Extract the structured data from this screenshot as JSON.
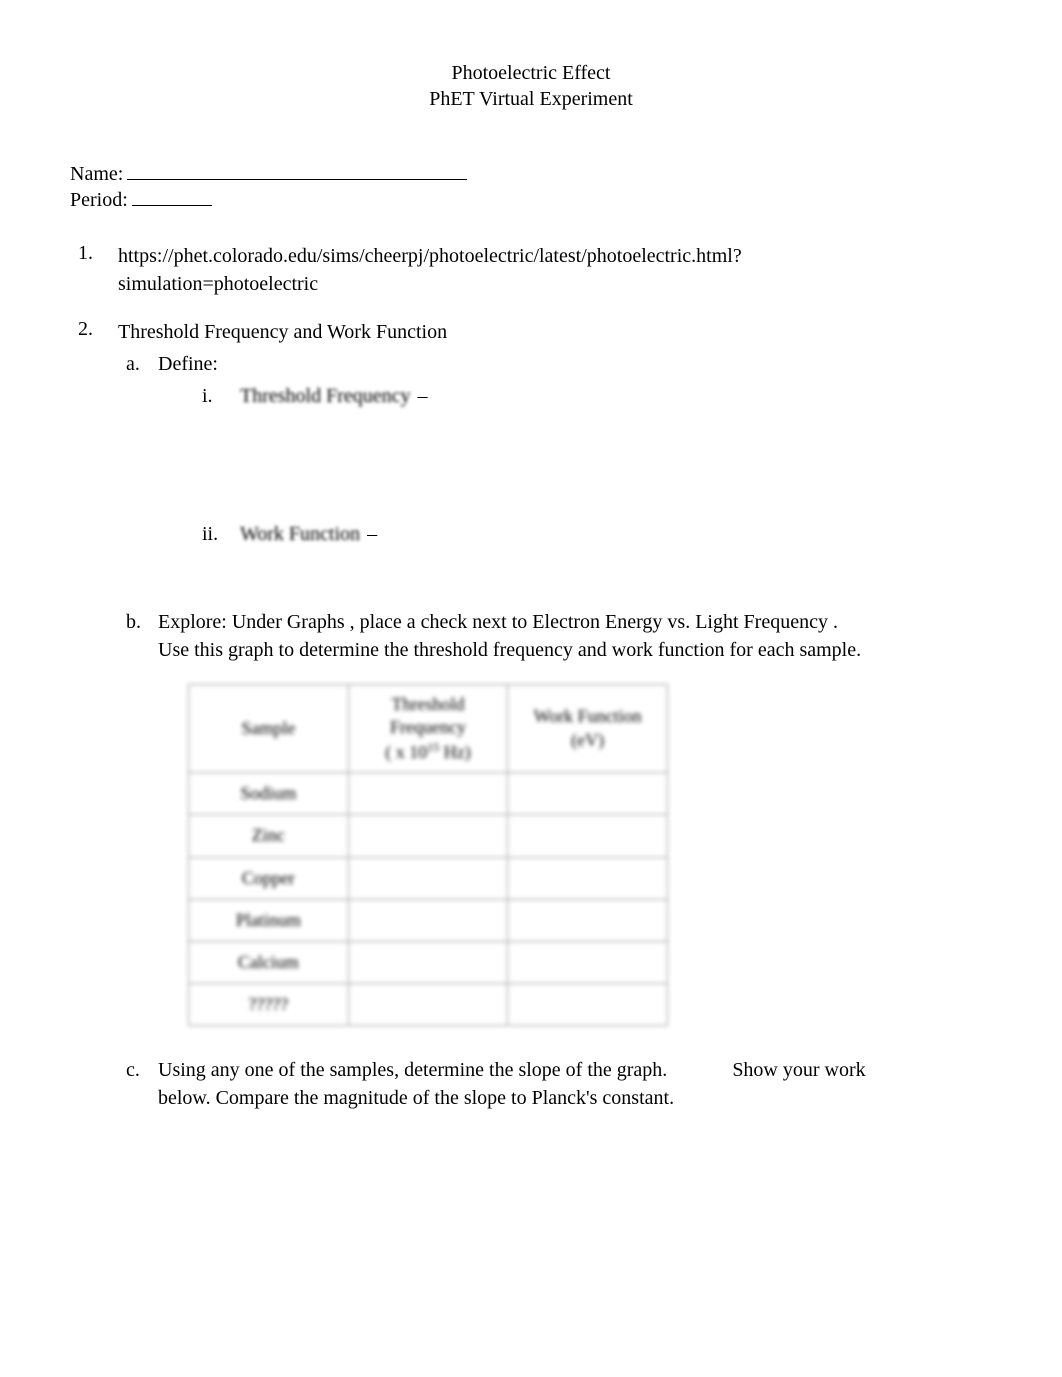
{
  "header": {
    "title1": "Photoelectric Effect",
    "title2": "PhET Virtual Experiment"
  },
  "info": {
    "name_label": "Name:",
    "period_label": "Period:"
  },
  "items": {
    "item1": {
      "marker": "1.",
      "url_line1": "https://phet.colorado.edu/sims/cheerpj/photoelectric/latest/photoelectric.html?",
      "url_line2": "simulation=photoelectric"
    },
    "item2": {
      "marker": "2.",
      "title": "Threshold Frequency and Work Function",
      "a": {
        "marker": "a.",
        "label": "Define:",
        "i": {
          "marker": "i.",
          "term": "Threshold Frequency",
          "dash": "–"
        },
        "ii": {
          "marker": "ii.",
          "term": "Work Function",
          "dash": "–"
        }
      },
      "b": {
        "marker": "b.",
        "text_pre": "Explore:    Under  Graphs  , place a check next to      Electron Energy vs. Light Frequency      .",
        "text_line2": "Use this graph to determine the threshold frequency and work function for each sample."
      },
      "c": {
        "marker": "c.",
        "text_line1a": "Using any one of the samples, determine the slope of the graph.",
        "text_line1b": "Show your work",
        "text_line2": "below.    Compare the magnitude of the slope to Planck's constant."
      }
    }
  },
  "table": {
    "headers": {
      "sample": "Sample",
      "threshold_line1": "Threshold",
      "threshold_line2": "Frequency",
      "threshold_unit": "( x 10",
      "threshold_exp": "15",
      "threshold_unit_end": " Hz)",
      "work_line1": "Work Function",
      "work_line2": "(eV)"
    },
    "rows": [
      {
        "sample": "Sodium",
        "threshold": "",
        "work": ""
      },
      {
        "sample": "Zinc",
        "threshold": "",
        "work": ""
      },
      {
        "sample": "Copper",
        "threshold": "",
        "work": ""
      },
      {
        "sample": "Platinum",
        "threshold": "",
        "work": ""
      },
      {
        "sample": "Calcium",
        "threshold": "",
        "work": ""
      },
      {
        "sample": "?????",
        "threshold": "",
        "work": ""
      }
    ]
  }
}
